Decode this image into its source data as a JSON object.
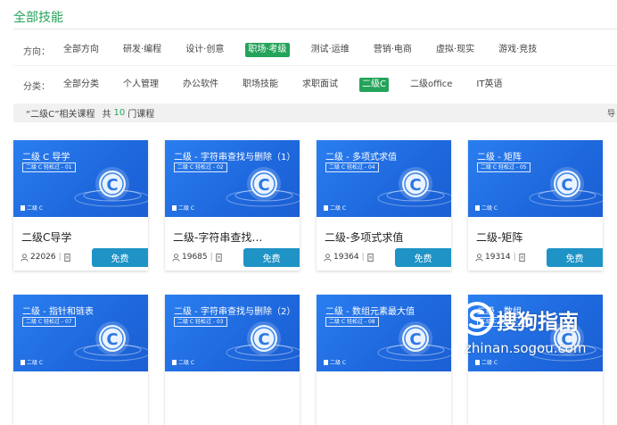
{
  "section_title": "全部技能",
  "direction": {
    "label": "方向：",
    "options": [
      "全部方向",
      "研发·编程",
      "设计·创意",
      "职场·考级",
      "测试·运维",
      "营销·电商",
      "虚拟·现实",
      "游戏·竞技"
    ],
    "selected": 3
  },
  "category": {
    "label": "分类：",
    "options": [
      "全部分类",
      "个人管理",
      "办公软件",
      "职场技能",
      "求职面试",
      "二级C",
      "二级office",
      "IT英语"
    ],
    "selected": 5
  },
  "result": {
    "prefix": "“二级C”相关课程",
    "total_label": "共",
    "count": "10",
    "suffix": "门课程",
    "edge_mark": "导"
  },
  "thumb_brand": "二级 C",
  "courses": [
    {
      "thumb_title": "二级 C 导学",
      "thumb_sub": "二级 C 轻松过 - 01",
      "name": "二级C导学",
      "students": "22026",
      "price": "免费"
    },
    {
      "thumb_title": "二级 - 字符串查找与删除（1）",
      "thumb_sub": "二级 C 轻松过 - 02",
      "name": "二级-字符串查找与...",
      "students": "19685",
      "price": "免费"
    },
    {
      "thumb_title": "二级 - 多项式求值",
      "thumb_sub": "二级 C 轻松过 - 04",
      "name": "二级-多项式求值",
      "students": "19364",
      "price": "免费"
    },
    {
      "thumb_title": "二级 - 矩阵",
      "thumb_sub": "二级 C 轻松过 - 05",
      "name": "二级-矩阵",
      "students": "19314",
      "price": "免费"
    },
    {
      "thumb_title": "二级 - 指针和链表",
      "thumb_sub": "二级 C 轻松过 - 07",
      "name": "",
      "students": "",
      "price": ""
    },
    {
      "thumb_title": "二级 - 字符串查找与删除（2）",
      "thumb_sub": "二级 C 轻松过 - 03",
      "name": "",
      "students": "",
      "price": ""
    },
    {
      "thumb_title": "二级 - 数组元素最大值",
      "thumb_sub": "二级 C 轻松过 - 08",
      "name": "",
      "students": "",
      "price": ""
    },
    {
      "thumb_title": "二级 - 数组",
      "thumb_sub": "二级 C 轻松过 - 06",
      "name": "",
      "students": "",
      "price": ""
    }
  ],
  "watermark": {
    "name": "搜狗指南",
    "url": "zhinan.sogou.com"
  },
  "colors": {
    "accent_green": "#24a35a",
    "free_button": "#1f93c6",
    "thumb_blue": "#1e68dd"
  }
}
